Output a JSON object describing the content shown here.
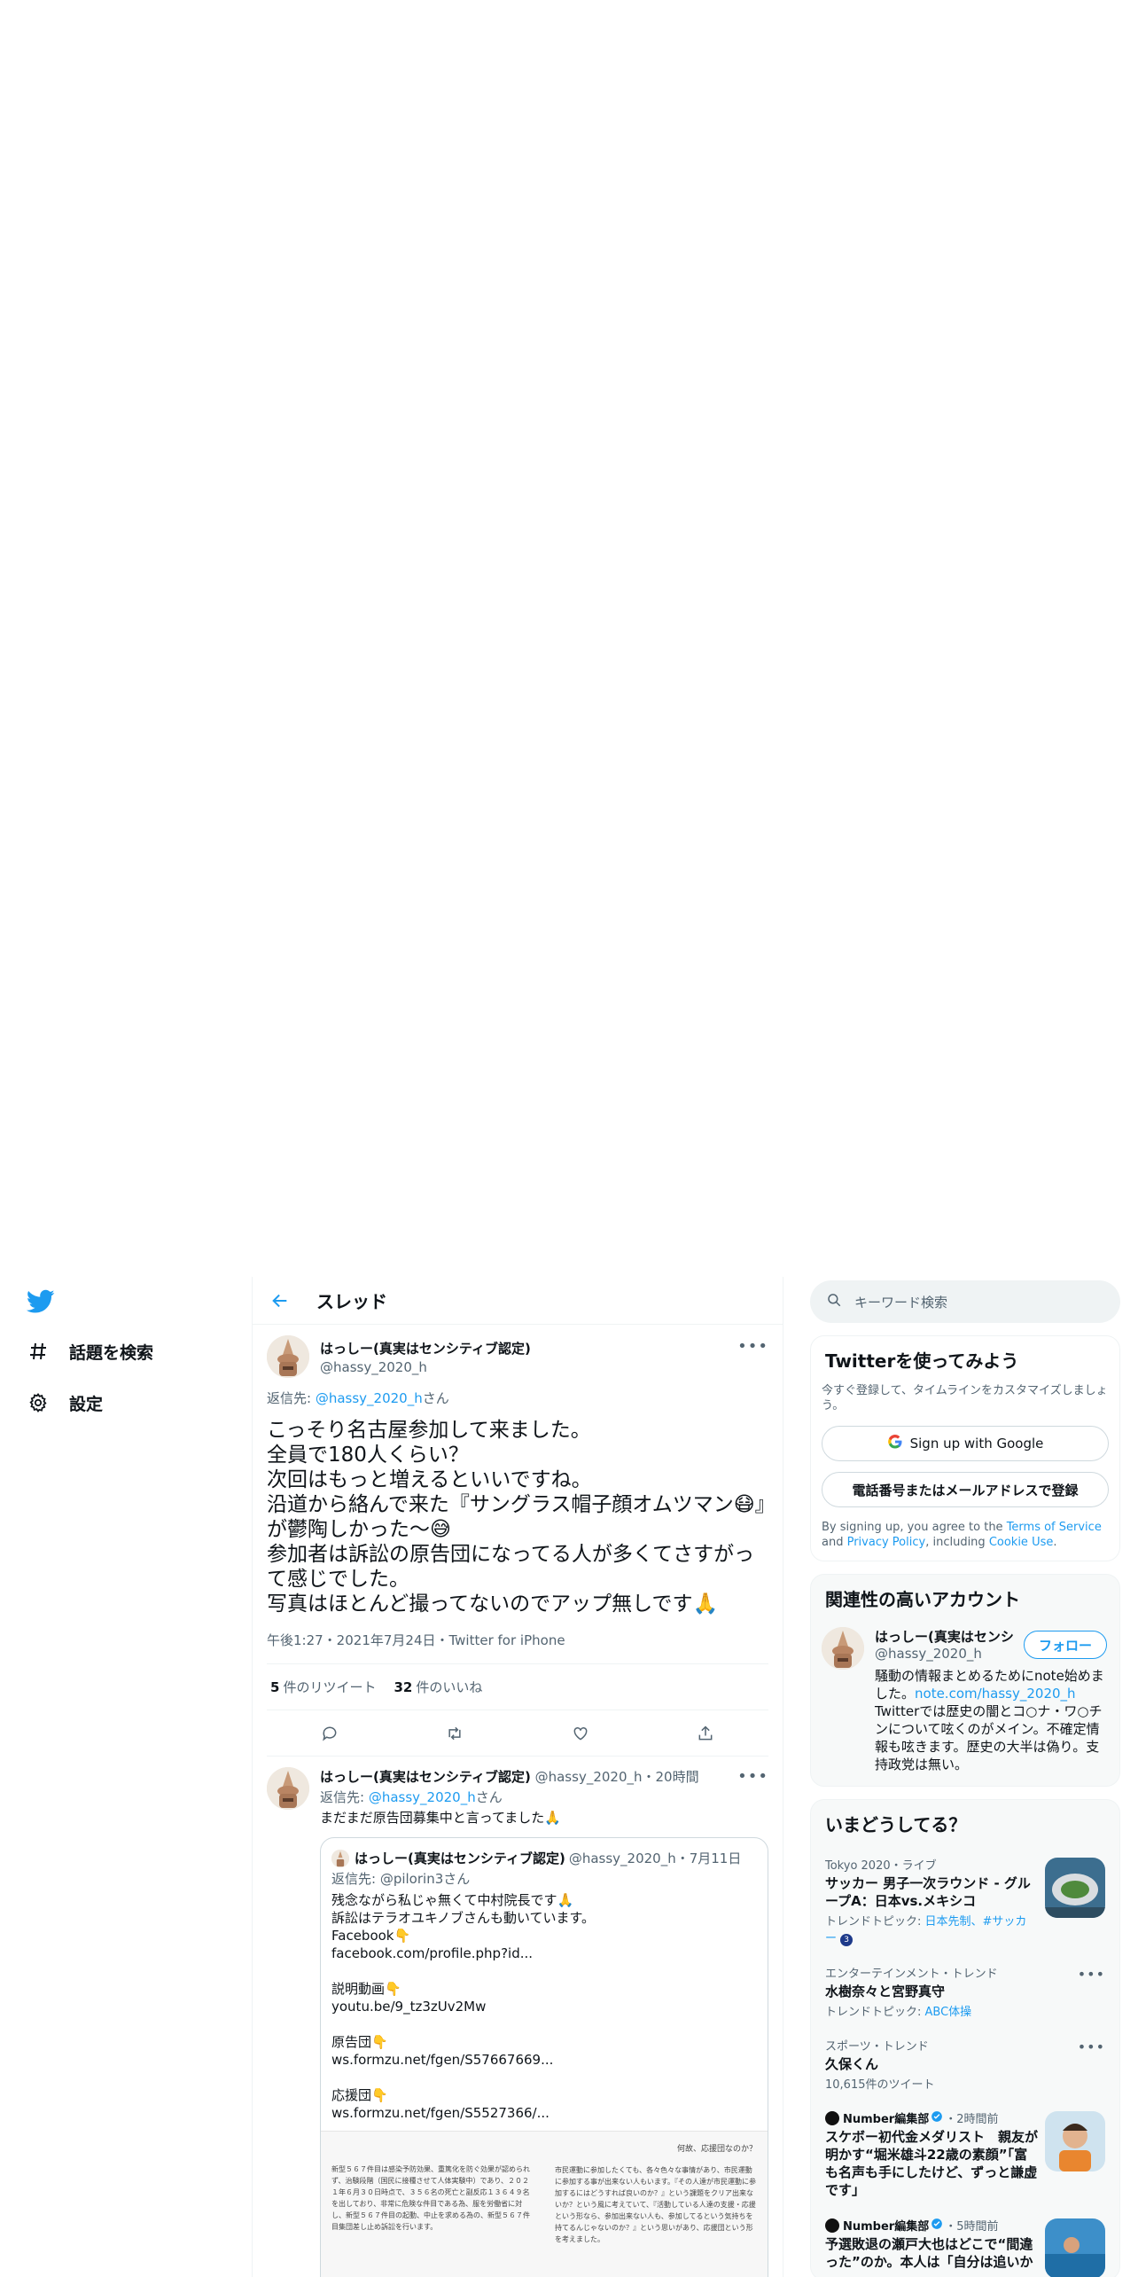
{
  "nav": {
    "items": [
      {
        "label": "話題を検索",
        "icon": "hashtag-icon"
      },
      {
        "label": "設定",
        "icon": "gear-icon"
      }
    ]
  },
  "header": {
    "title": "スレッド"
  },
  "main_tweet": {
    "name": "はっしー(真実はセンシティブ認定)",
    "handle": "@hassy_2020_h",
    "replying_prefix": "返信先: ",
    "replying_to": "@hassy_2020_h",
    "replying_suffix": "さん",
    "text": "こっそり名古屋参加して来ました。\n全員で180人くらい？\n次回はもっと増えるといいですね。\n沿道から絡んで来た『サングラス帽子顔オムツマン😷』が鬱陶しかった〜😅\n参加者は訴訟の原告団になってる人が多くてさすがって感じでした。\n写真はほとんど撮ってないのでアップ無しです🙏",
    "meta": "午後1:27・2021年7月24日・Twitter for iPhone",
    "retweets_count": "5",
    "retweets_label": "件のリツイート",
    "likes_count": "32",
    "likes_label": "件のいいね"
  },
  "reply_tweet": {
    "name": "はっしー(真実はセンシティブ認定)",
    "handle_time": "@hassy_2020_h・20時間",
    "replying_prefix": "返信先: ",
    "replying_to": "@hassy_2020_h",
    "replying_suffix": "さん",
    "text": "まだまだ原告団募集中と言ってました🙏",
    "quote": {
      "name": "はっしー(真実はセンシティブ認定)",
      "handle_date": "@hassy_2020_h・7月11日",
      "replying_line": "返信先: @pilorin3さん",
      "text": "残念ながら私じゃ無くて中村院長です🙏\n訴訟はテラオユキノブさんも動いています。\nFacebook👇\nfacebook.com/profile.php?id...\n\n説明動画👇\nyoutu.be/9_tz3zUv2Mw\n\n原告団👇\nws.formzu.net/fgen/S57667669...\n\n応援団👇\nws.formzu.net/fgen/S5527366/...",
      "doc_left": "新型５６７件目は感染予防効果、重篤化を防ぐ効果が認められず、治験段階（国民に接種させて人体実験中）であり、２０２１年６月３０日時点で、３５６名の死亡と副反応１３６４９名を出しており、非常に危険な件目である為、服を労働省に対し、新型５６７件目の起動、中止を求める為の、新型５６７件目集団差し止め訴訟を行います。",
      "doc_right_title": "何故、応援団なのか？",
      "doc_right": "市民運動に参加したくても、各々色々な事情があり、市民運動に参加する事が出来ない人もいます。『その人達が市民運動に参加するにはどうすれば良いのか？』という課題をクリア出来ないか？という風に考えていて、『活動している人達の支援・応援という形なら、参加出来ない人も、参加してるという気持ちを持てるんじゃないのか？』という思いがあり、応援団という形を考えました。"
    }
  },
  "search": {
    "placeholder": "キーワード検索"
  },
  "signup": {
    "title": "Twitterを使ってみよう",
    "subtitle": "今すぐ登録して、タイムラインをカスタマイズしましょう。",
    "google_button": "Sign up with Google",
    "phone_button": "電話番号またはメールアドレスで登録",
    "legal_prefix": "By signing up, you agree to the ",
    "terms": "Terms of Service",
    "legal_and": " and ",
    "privacy": "Privacy Policy",
    "legal_including": ", including ",
    "cookie": "Cookie Use",
    "legal_end": "."
  },
  "related": {
    "title": "関連性の高いアカウント",
    "name": "はっしー(真実はセンシ",
    "handle": "@hassy_2020_h",
    "follow_label": "フォロー",
    "bio_prefix": "騒動の情報まとめるためにnote始めました。",
    "bio_link": "note.com/hassy_2020_h",
    "bio_suffix": " Twitterでは歴史の闇とコ○ナ・ワ○チンについて呟くのがメイン。不確定情報も呟きます。歴史の大半は偽り。支持政党は無い。"
  },
  "trends": {
    "title": "いまどうしてる？",
    "items": [
      {
        "context": "Tokyo 2020・ライブ",
        "headline": "サッカー 男子一次ラウンド - グループA：日本vs.メキシコ",
        "sub_prefix": "トレンドトピック: ",
        "sub_links": "日本先制、#サッカー",
        "badge": "3"
      },
      {
        "context": "エンターテインメント・トレンド",
        "headline": "水樹奈々と宮野真守",
        "sub_prefix": "トレンドトピック: ",
        "sub_links": "ABC体操"
      },
      {
        "context": "スポーツ・トレンド",
        "headline": "久保くん",
        "count": "10,615件のツイート"
      },
      {
        "source": "Number編集部",
        "time": "・2時間前",
        "headline": "スケボー初代金メダリスト　親友が明かす“堀米雄斗22歳の素顔”「富も名声も手にしたけど、ずっと謙虚です」"
      },
      {
        "source": "Number編集部",
        "time": "・5時間前",
        "headline": "予選敗退の瀬戸大也はどこで“間違った”のか。本人は「自分は追いか"
      }
    ]
  },
  "colors": {
    "accent": "#1d9bf0",
    "text": "#0f1419",
    "muted": "#536471",
    "border": "#eff3f4"
  }
}
